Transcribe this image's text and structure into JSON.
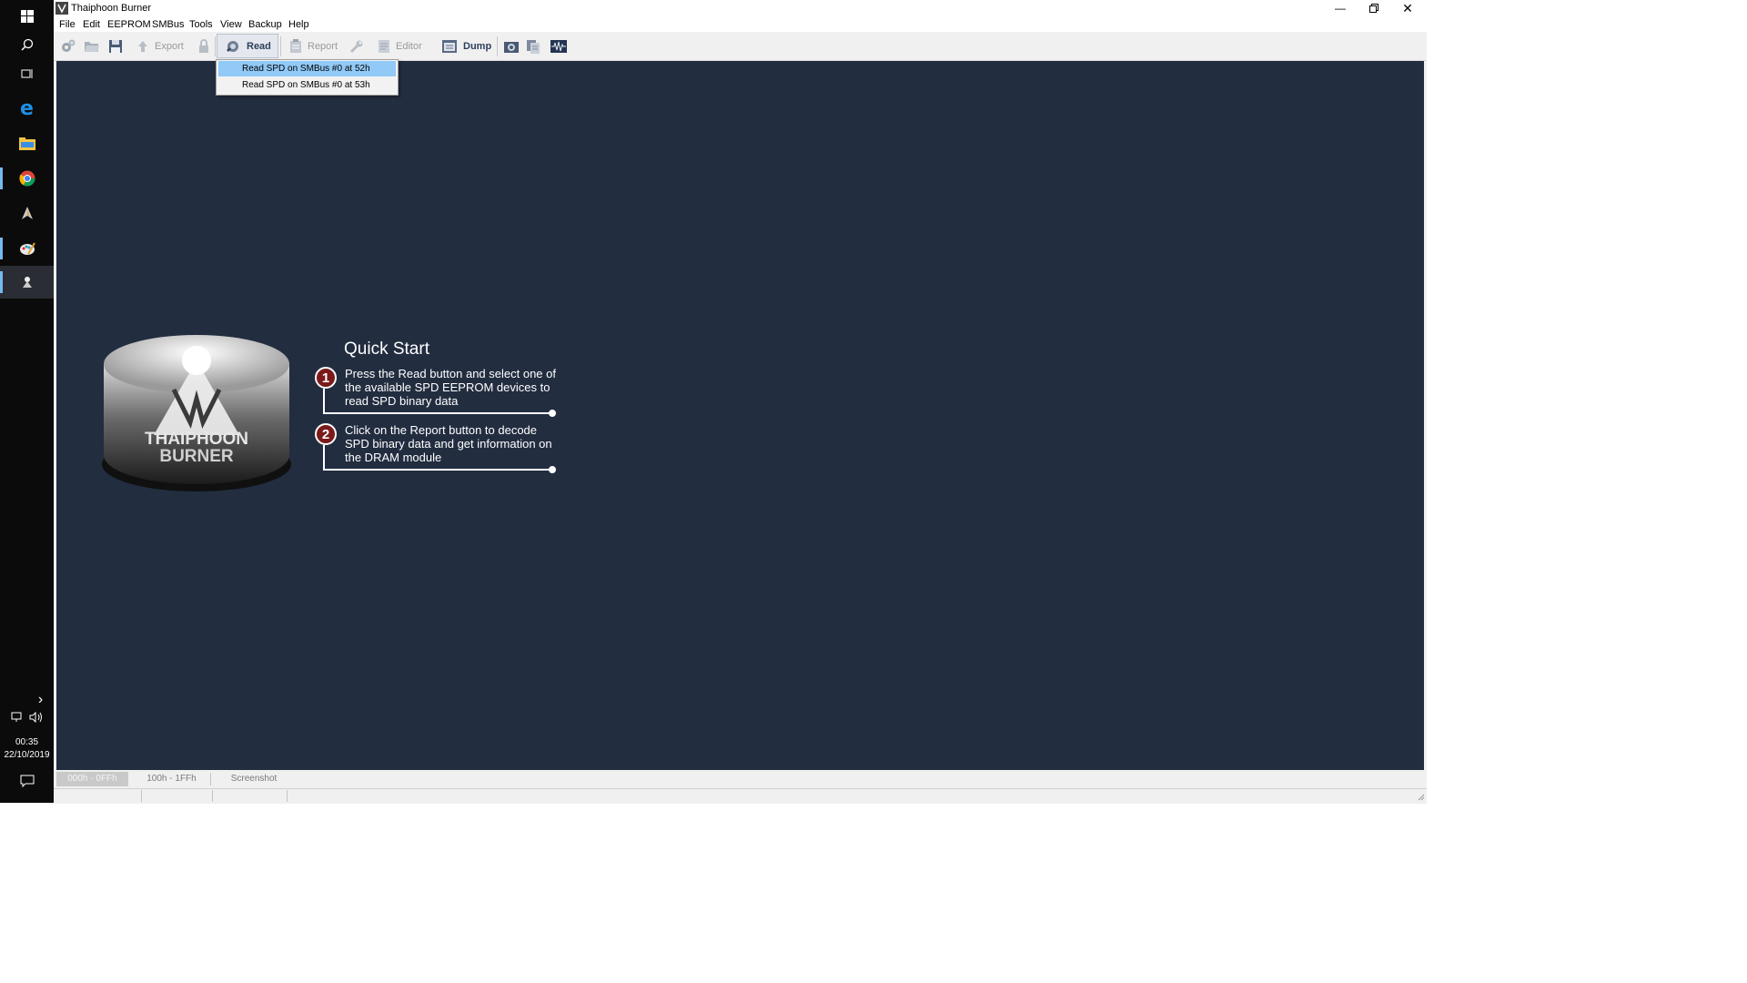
{
  "window": {
    "title": "Thaiphoon Burner"
  },
  "menu": [
    "File",
    "Edit",
    "EEPROM",
    "SMBus",
    "Tools",
    "View",
    "Backup",
    "Help"
  ],
  "toolbar": {
    "export_label": "Export",
    "read_label": "Read",
    "report_label": "Report",
    "editor_label": "Editor",
    "dump_label": "Dump"
  },
  "read_dropdown": {
    "items": [
      "Read SPD on SMBus #0 at 52h",
      "Read SPD on SMBus #0 at 53h"
    ],
    "highlighted_index": 0
  },
  "logo": {
    "line1": "THAIPHOON",
    "line2": "BURNER"
  },
  "quick_start": {
    "title": "Quick Start",
    "steps": [
      {
        "number": "1",
        "text": "Press the Read button and select one of the available SPD EEPROM devices to read SPD binary data"
      },
      {
        "number": "2",
        "text": "Click on the Report button to decode SPD binary data and get information on the DRAM module"
      }
    ]
  },
  "bottom_tabs": [
    "000h - 0FFh",
    "100h - 1FFh",
    "Screenshot"
  ],
  "taskbar": {
    "time": "00:35",
    "date": "22/10/2019"
  },
  "colors": {
    "content_bg": "#222d40",
    "accent_red": "#7b1a1a",
    "menu_highlight": "#91c9f7"
  }
}
